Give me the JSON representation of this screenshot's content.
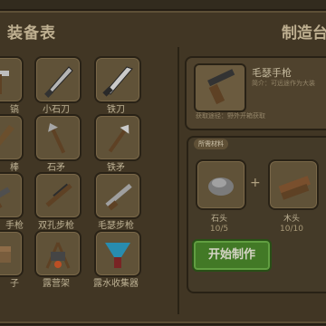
{
  "left_panel": {
    "title": "装备表"
  },
  "right_panel": {
    "title": "制造台"
  },
  "grid": {
    "items": [
      {
        "label": "镐",
        "icon": "pickaxe-icon"
      },
      {
        "label": "小石刀",
        "icon": "stone-knife-icon"
      },
      {
        "label": "铁刀",
        "icon": "iron-knife-icon"
      },
      {
        "label": "棒",
        "icon": "club-icon"
      },
      {
        "label": "石矛",
        "icon": "stone-spear-icon"
      },
      {
        "label": "铁矛",
        "icon": "iron-spear-icon"
      },
      {
        "label": "手枪",
        "icon": "pistol-icon"
      },
      {
        "label": "双孔步枪",
        "icon": "double-barrel-rifle-icon"
      },
      {
        "label": "毛瑟步枪",
        "icon": "mauser-rifle-icon"
      },
      {
        "label": "子",
        "icon": "box-icon"
      },
      {
        "label": "露营架",
        "icon": "camp-stand-icon"
      },
      {
        "label": "露水收集器",
        "icon": "dew-collector-icon"
      }
    ]
  },
  "detail": {
    "title": "毛瑟手枪",
    "description": "简介：可远途作为大装",
    "source": "获取途径：野外开箱获取",
    "icon": "mauser-pistol-icon"
  },
  "materials": {
    "tag": "所需材料",
    "items": [
      {
        "name": "石头",
        "count": "10/5",
        "icon": "stone-icon"
      },
      {
        "name": "木头",
        "count": "10/10",
        "icon": "wood-icon"
      }
    ],
    "plus": "+"
  },
  "craft_button": {
    "label": "开始制作"
  },
  "colors": {
    "panel": "#4a3e2a",
    "tile": "#6e5e40",
    "button": "#4c8a2c"
  }
}
